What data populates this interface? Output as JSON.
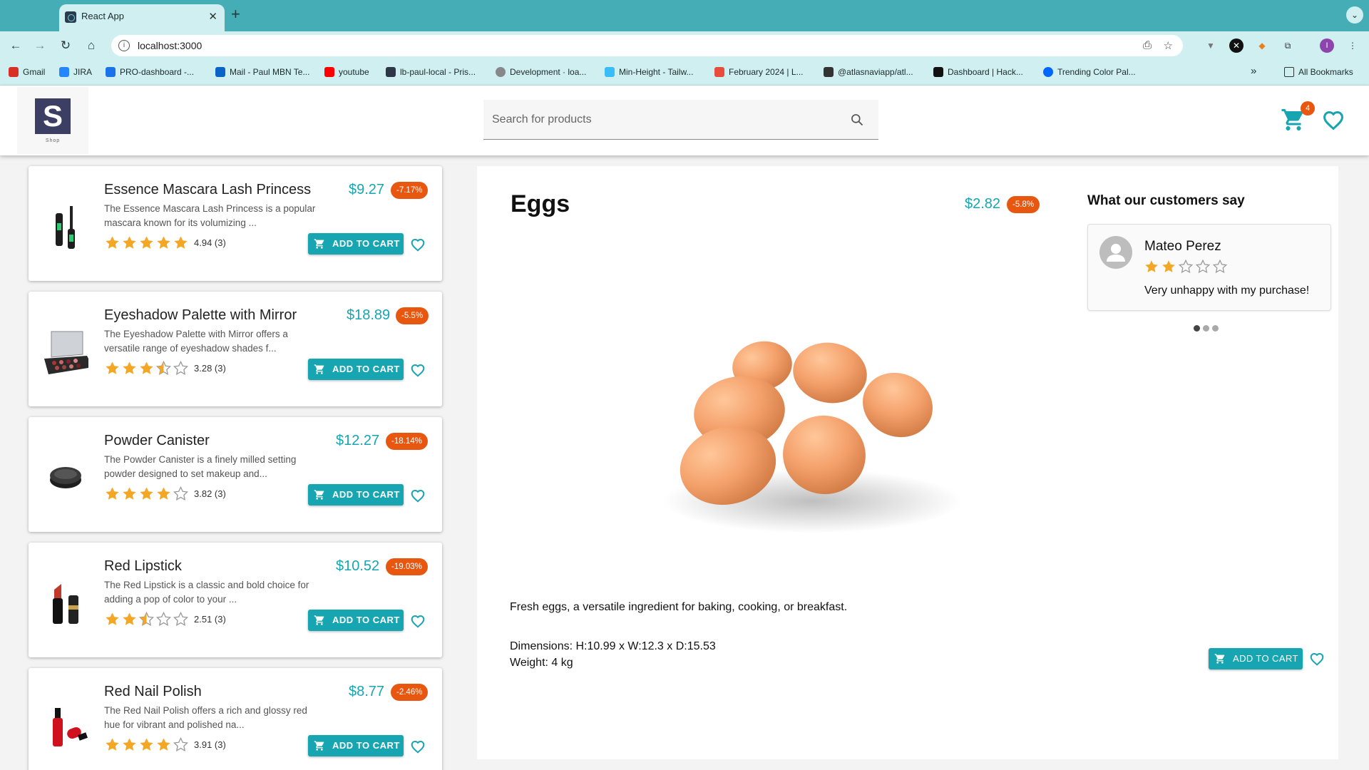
{
  "browser": {
    "tab_title": "React App",
    "tab_close": "✕",
    "new_tab": "+",
    "url": "localhost:3000",
    "bookmarks": [
      {
        "label": "Gmail",
        "icon": "gmail-icon",
        "color": "#d93025"
      },
      {
        "label": "JIRA",
        "icon": "jira-icon",
        "color": "#2684ff"
      },
      {
        "label": "PRO-dashboard -...",
        "icon": "dashboard-icon",
        "color": "#1a73e8"
      },
      {
        "label": "Mail - Paul MBN Te...",
        "icon": "outlook-icon",
        "color": "#0a64c8"
      },
      {
        "label": "youtube",
        "icon": "youtube-icon",
        "color": "#ff0000"
      },
      {
        "label": "lb-paul-local - Pris...",
        "icon": "prisma-icon",
        "color": "#2d3748"
      },
      {
        "label": "Development · loa...",
        "icon": "github-icon",
        "color": "#888888"
      },
      {
        "label": "Min-Height - Tailw...",
        "icon": "tailwind-icon",
        "color": "#38bdf8"
      },
      {
        "label": "February 2024 | L...",
        "icon": "calendar-icon",
        "color": "#e84c3d"
      },
      {
        "label": "@atlasnaviapp/atl...",
        "icon": "atlas-icon",
        "color": "#333333"
      },
      {
        "label": "Dashboard | Hack...",
        "icon": "hackerrank-icon",
        "color": "#111111"
      },
      {
        "label": "Trending Color Pal...",
        "icon": "coolors-icon",
        "color": "#0066ff"
      }
    ],
    "bookmarks_more": "»",
    "all_bookmarks": "All Bookmarks",
    "profile_initial": "I"
  },
  "header": {
    "logo_letter": "S",
    "logo_sub": "Shop",
    "search_placeholder": "Search for products",
    "cart_count": "4"
  },
  "products": [
    {
      "title": "Essence Mascara Lash Princess",
      "price": "$9.27",
      "discount": "-7.17%",
      "desc_line1": "The Essence Mascara Lash Princess is a popular",
      "desc_line2": "mascara known for its volumizing ...",
      "rating": 4.94,
      "rating_text": "4.94 (3)",
      "thumb": "mascara"
    },
    {
      "title": "Eyeshadow Palette with Mirror",
      "price": "$18.89",
      "discount": "-5.5%",
      "desc_line1": "The Eyeshadow Palette with Mirror offers a",
      "desc_line2": "versatile range of eyeshadow shades f...",
      "rating": 3.28,
      "rating_text": "3.28 (3)",
      "thumb": "palette"
    },
    {
      "title": "Powder Canister",
      "price": "$12.27",
      "discount": "-18.14%",
      "desc_line1": "The Powder Canister is a finely milled setting",
      "desc_line2": "powder designed to set makeup and...",
      "rating": 3.82,
      "rating_text": "3.82 (3)",
      "thumb": "powder"
    },
    {
      "title": "Red Lipstick",
      "price": "$10.52",
      "discount": "-19.03%",
      "desc_line1": "The Red Lipstick is a classic and bold choice for",
      "desc_line2": "adding a pop of color to your ...",
      "rating": 2.51,
      "rating_text": "2.51 (3)",
      "thumb": "lipstick"
    },
    {
      "title": "Red Nail Polish",
      "price": "$8.77",
      "discount": "-2.46%",
      "desc_line1": "The Red Nail Polish offers a rich and glossy red",
      "desc_line2": "hue for vibrant and polished na...",
      "rating": 3.91,
      "rating_text": "3.91 (3)",
      "thumb": "nailpolish"
    }
  ],
  "add_to_cart_label": "ADD TO CART",
  "detail": {
    "title": "Eggs",
    "price": "$2.82",
    "discount": "-5.8%",
    "description": "Fresh eggs, a versatile ingredient for baking, cooking, or breakfast.",
    "dimensions": "Dimensions: H:10.99 x W:12.3 x D:15.53",
    "weight": "Weight: 4 kg",
    "add_to_cart": "ADD TO CART",
    "reviews_title": "What our customers say",
    "review": {
      "name": "Mateo Perez",
      "rating": 2,
      "text": "Very unhappy with my purchase!"
    },
    "review_count": 3,
    "active_review": 1
  },
  "colors": {
    "accent": "#17a5b1",
    "discount": "#e8570f",
    "star": "#f5a623",
    "chrome": "#45adb5"
  }
}
